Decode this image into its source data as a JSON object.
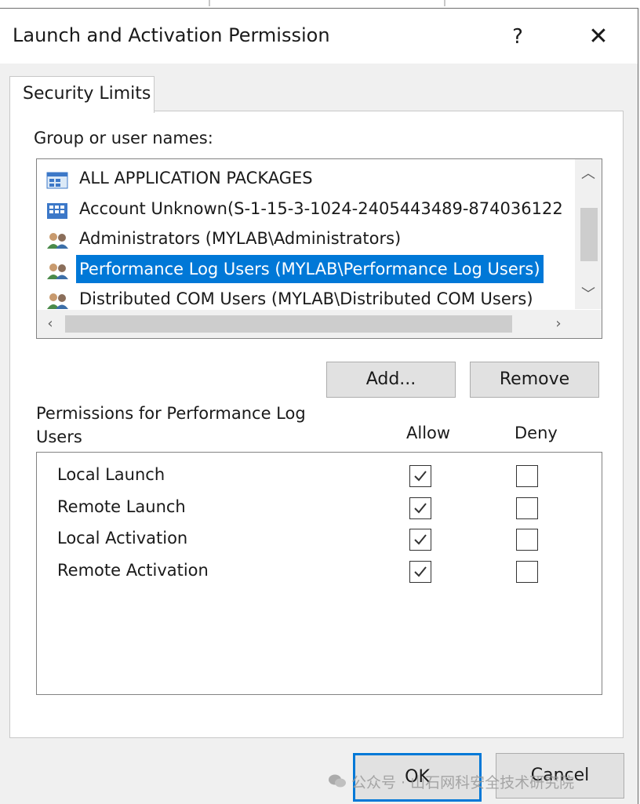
{
  "window": {
    "title": "Launch and Activation Permission",
    "help_label": "?",
    "close_label": "✕"
  },
  "tab": {
    "label": "Security Limits"
  },
  "group_list": {
    "label": "Group or user names:",
    "items": [
      {
        "label": "ALL APPLICATION PACKAGES",
        "icon": "app-packages-icon",
        "selected": false
      },
      {
        "label": "Account Unknown(S-1-15-3-1024-2405443489-874036122",
        "icon": "unknown-account-icon",
        "selected": false
      },
      {
        "label": "Administrators (MYLAB\\Administrators)",
        "icon": "users-group-icon",
        "selected": false
      },
      {
        "label": "Performance Log Users (MYLAB\\Performance Log Users)",
        "icon": "users-group-icon",
        "selected": true
      },
      {
        "label": "Distributed COM Users (MYLAB\\Distributed COM Users)",
        "icon": "users-group-icon",
        "selected": false
      }
    ]
  },
  "buttons": {
    "add": "Add...",
    "remove": "Remove",
    "ok": "OK",
    "cancel": "Cancel"
  },
  "permissions": {
    "title": "Permissions for Performance Log Users",
    "allow_header": "Allow",
    "deny_header": "Deny",
    "rows": [
      {
        "label": "Local Launch",
        "allow": true,
        "deny": false
      },
      {
        "label": "Remote Launch",
        "allow": true,
        "deny": false
      },
      {
        "label": "Local Activation",
        "allow": true,
        "deny": false
      },
      {
        "label": "Remote Activation",
        "allow": true,
        "deny": false
      }
    ]
  },
  "watermark": {
    "text": "公众号 · 山石网科安全技术研究院"
  },
  "colors": {
    "selection": "#0078d7",
    "default_button_border": "#0078d7"
  }
}
